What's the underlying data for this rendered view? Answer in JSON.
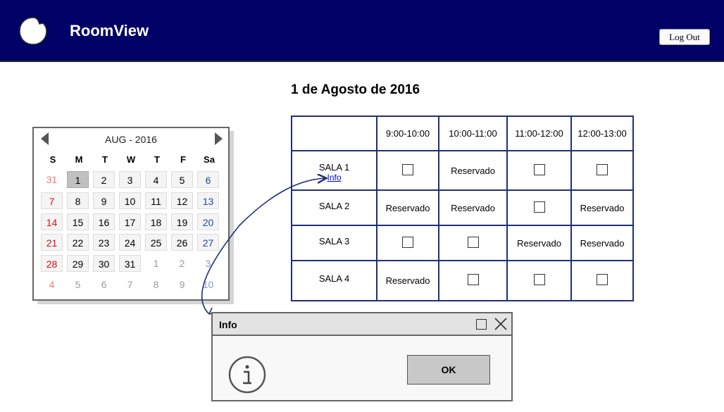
{
  "app": {
    "title": "RoomView",
    "logout_label": "Log Out"
  },
  "page": {
    "date_title": "1 de Agosto de 2016"
  },
  "calendar": {
    "month_label": "AUG - 2016",
    "weekdays": [
      "S",
      "M",
      "T",
      "W",
      "T",
      "F",
      "Sa"
    ],
    "weeks": [
      [
        "31",
        "1",
        "2",
        "3",
        "4",
        "5",
        "6"
      ],
      [
        "7",
        "8",
        "9",
        "10",
        "11",
        "12",
        "13"
      ],
      [
        "14",
        "15",
        "16",
        "17",
        "18",
        "19",
        "20"
      ],
      [
        "21",
        "22",
        "23",
        "24",
        "25",
        "26",
        "27"
      ],
      [
        "28",
        "29",
        "30",
        "31",
        "1",
        "2",
        "3"
      ],
      [
        "4",
        "5",
        "6",
        "7",
        "8",
        "9",
        "10"
      ]
    ],
    "selected_day": "1"
  },
  "schedule": {
    "time_slots": [
      "9:00-10:00",
      "10:00-11:00",
      "11:00-12:00",
      "12:00-13:00"
    ],
    "info_label": "Info",
    "reserved_label": "Reservado",
    "rooms": [
      {
        "name": "SALA 1",
        "has_info": true,
        "slots": [
          "free",
          "Reservado",
          "free",
          "free"
        ]
      },
      {
        "name": "SALA 2",
        "has_info": false,
        "slots": [
          "Reservado",
          "Reservado",
          "free",
          "Reservado"
        ]
      },
      {
        "name": "SALA 3",
        "has_info": false,
        "slots": [
          "free",
          "free",
          "Reservado",
          "Reservado"
        ]
      },
      {
        "name": "SALA 4",
        "has_info": false,
        "slots": [
          "Reservado",
          "free",
          "free",
          "free"
        ]
      }
    ]
  },
  "dialog": {
    "title": "Info",
    "ok_label": "OK",
    "icon": "info-icon"
  },
  "colors": {
    "header_bg": "#000066",
    "table_border": "#1f2f7a",
    "connector": "#1f2f7a"
  }
}
